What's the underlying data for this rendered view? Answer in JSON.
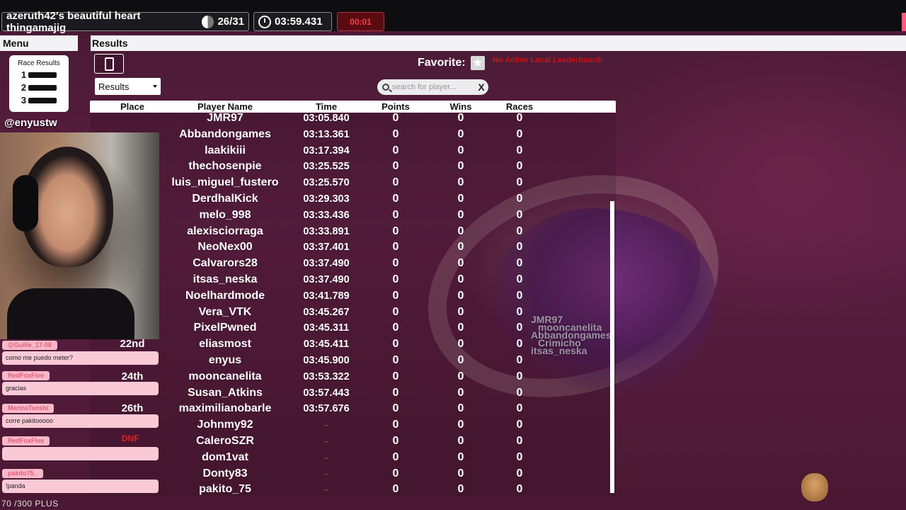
{
  "topbar": {
    "race_title": "azeruth42's beautiful heart thingamajig",
    "progress": "26/31",
    "timer": "03:59.431",
    "status": "00:01"
  },
  "menu": {
    "header": "Menu",
    "race_results_label": "Race Results",
    "podium": [
      "1",
      "2",
      "3"
    ]
  },
  "results": {
    "header": "Results",
    "select_value": "Results",
    "favorite_label": "Favorite:",
    "leaderboard_warning": "No Active Local Leaderboard!",
    "search_placeholder": "search for player...",
    "search_clear": "X",
    "columns": [
      "Place",
      "Player Name",
      "Time",
      "Points",
      "Wins",
      "Races"
    ]
  },
  "table_rows": [
    {
      "place": "",
      "name": "JMR97",
      "time": "03:05.840",
      "points": "0",
      "wins": "0",
      "races": "0"
    },
    {
      "place": "",
      "name": "Abbandongames",
      "time": "03:13.361",
      "points": "0",
      "wins": "0",
      "races": "0"
    },
    {
      "place": "",
      "name": "laakikiii",
      "time": "03:17.394",
      "points": "0",
      "wins": "0",
      "races": "0"
    },
    {
      "place": "",
      "name": "thechosenpie",
      "time": "03:25.525",
      "points": "0",
      "wins": "0",
      "races": "0"
    },
    {
      "place": "",
      "name": "luis_miguel_fustero",
      "time": "03:25.570",
      "points": "0",
      "wins": "0",
      "races": "0"
    },
    {
      "place": "",
      "name": "DerdhalKick",
      "time": "03:29.303",
      "points": "0",
      "wins": "0",
      "races": "0"
    },
    {
      "place": "",
      "name": "melo_998",
      "time": "03:33.436",
      "points": "0",
      "wins": "0",
      "races": "0"
    },
    {
      "place": "",
      "name": "alexisciorraga",
      "time": "03:33.891",
      "points": "0",
      "wins": "0",
      "races": "0"
    },
    {
      "place": "",
      "name": "NeoNex00",
      "time": "03:37.401",
      "points": "0",
      "wins": "0",
      "races": "0"
    },
    {
      "place": "",
      "name": "Calvarors28",
      "time": "03:37.490",
      "points": "0",
      "wins": "0",
      "races": "0"
    },
    {
      "place": "",
      "name": "itsas_neska",
      "time": "03:37.490",
      "points": "0",
      "wins": "0",
      "races": "0"
    },
    {
      "place": "",
      "name": "Noelhardmode",
      "time": "03:41.789",
      "points": "0",
      "wins": "0",
      "races": "0"
    },
    {
      "place": "",
      "name": "Vera_VTK",
      "time": "03:45.267",
      "points": "0",
      "wins": "0",
      "races": "0"
    },
    {
      "place": "",
      "name": "PixelPwned",
      "time": "03:45.311",
      "points": "0",
      "wins": "0",
      "races": "0"
    },
    {
      "place": "22nd",
      "name": "eliasmost",
      "time": "03:45.411",
      "points": "0",
      "wins": "0",
      "races": "0"
    },
    {
      "place": "",
      "name": "enyus",
      "time": "03:45.900",
      "points": "0",
      "wins": "0",
      "races": "0"
    },
    {
      "place": "24th",
      "name": "mooncanelita",
      "time": "03:53.322",
      "points": "0",
      "wins": "0",
      "races": "0"
    },
    {
      "place": "",
      "name": "Susan_Atkins",
      "time": "03:57.443",
      "points": "0",
      "wins": "0",
      "races": "0"
    },
    {
      "place": "26th",
      "name": "maximilianobarle",
      "time": "03:57.676",
      "points": "0",
      "wins": "0",
      "races": "0"
    },
    {
      "place": "",
      "name": "Johnmy92",
      "time": "-",
      "points": "0",
      "wins": "0",
      "races": "0"
    },
    {
      "place": "",
      "name": "CaleroSZR",
      "time": "-",
      "points": "0",
      "wins": "0",
      "races": "0"
    },
    {
      "place": "",
      "name": "dom1vat",
      "time": "-",
      "points": "0",
      "wins": "0",
      "races": "0"
    },
    {
      "place": "",
      "name": "Donty83",
      "time": "-",
      "points": "0",
      "wins": "0",
      "races": "0"
    },
    {
      "place": "",
      "name": "pakito_75",
      "time": "-",
      "points": "0",
      "wins": "0",
      "races": "0"
    }
  ],
  "marble_names": [
    "JMR97",
    "mooncanelita",
    "Abbandongames",
    "Crimicho",
    "itsas_neska"
  ],
  "webcam": {
    "handle": "@enyustw"
  },
  "chat": [
    {
      "user": "@Guille_17-08",
      "text": "como me puedo meter?"
    },
    {
      "user": "RedFoxFive",
      "text": "gracias"
    },
    {
      "user": "MarinaTenshi",
      "text": "corre pakitooooo"
    },
    {
      "user": "RedFoxFive",
      "text": ""
    },
    {
      "user": "pakito75_",
      "text": "!panda"
    }
  ],
  "chat_overlay": {
    "dnf": "DNF"
  },
  "footer": {
    "status": "70 /300 PLUS"
  },
  "colors": {
    "accent": "#5b1f41",
    "warning": "#d01010",
    "chat_user": "#e25e7d",
    "chat_bg": "#f9cad6"
  }
}
